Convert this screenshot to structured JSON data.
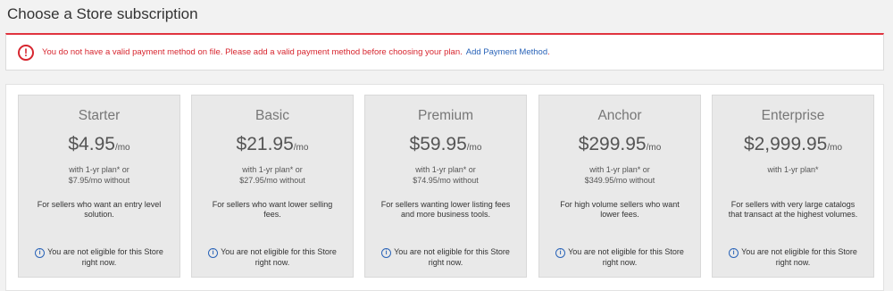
{
  "page": {
    "title": "Choose a Store subscription"
  },
  "alert": {
    "icon": "alert-circle-icon",
    "message": "You do not have a valid payment method on file. Please add a valid payment method before choosing your plan.",
    "link_label": "Add Payment Method",
    "trailing": ".",
    "colors": {
      "border": "#e0333f",
      "text": "#d7262f",
      "link": "#2a64b8"
    }
  },
  "plans": [
    {
      "name": "Starter",
      "price": "$4.95",
      "per": "/mo",
      "terms_line1": "with 1-yr plan* or",
      "terms_line2": "$7.95/mo without",
      "description": "For sellers who want an entry level solution.",
      "eligibility": "You are not eligible for this Store right now."
    },
    {
      "name": "Basic",
      "price": "$21.95",
      "per": "/mo",
      "terms_line1": "with 1-yr plan* or",
      "terms_line2": "$27.95/mo without",
      "description": "For sellers who want lower selling fees.",
      "eligibility": "You are not eligible for this Store right now."
    },
    {
      "name": "Premium",
      "price": "$59.95",
      "per": "/mo",
      "terms_line1": "with 1-yr plan* or",
      "terms_line2": "$74.95/mo without",
      "description": "For sellers wanting lower listing fees and more business tools.",
      "eligibility": "You are not eligible for this Store right now."
    },
    {
      "name": "Anchor",
      "price": "$299.95",
      "per": "/mo",
      "terms_line1": "with 1-yr plan* or",
      "terms_line2": "$349.95/mo without",
      "description": "For high volume sellers who want lower fees.",
      "eligibility": "You are not eligible for this Store right now."
    },
    {
      "name": "Enterprise",
      "price": "$2,999.95",
      "per": "/mo",
      "terms_line1": "with 1-yr plan*",
      "terms_line2": "",
      "description": "For sellers with very large catalogs that transact at the highest volumes.",
      "eligibility": "You are not eligible for this Store right now."
    }
  ]
}
